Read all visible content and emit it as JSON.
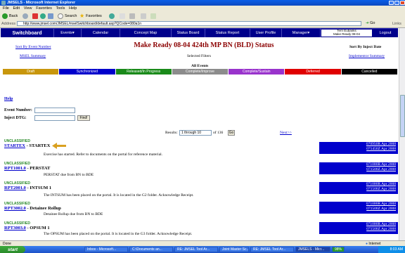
{
  "window": {
    "title": "JMSELS - Microsoft Internet Explorer"
  },
  "ie_menu": [
    "File",
    "Edit",
    "View",
    "Favorites",
    "Tools",
    "Help"
  ],
  "toolbar": {
    "back": "Back",
    "search": "Search",
    "favorites": "Favorites"
  },
  "addressbar": {
    "label": "Address",
    "url": "http://www.jmsel.com/JMSEL/mselSwitchboard/default.asp?QCode=080a1n",
    "go": "Go",
    "links": "Links"
  },
  "nav": {
    "switchboard": "Switchboard",
    "events": "Events▾",
    "calendar": "Calendar",
    "concept_map": "Concept Map",
    "status_board": "Status Board",
    "status_report": "Status Report",
    "user_profile": "User Profile",
    "managers": "Manager▾",
    "user_name": "Terri Eubanks",
    "user_event": "Make Ready 08-04",
    "logout": "Logout"
  },
  "page": {
    "sort_event_number": "Sort By Event Number",
    "msel_summary": "MSEL Summary",
    "title": "Make Ready 08-04 424th MP BN (BLD) Status",
    "selected_filters": "Selected Filters",
    "sort_inject_date": "Sort By Inject Date",
    "implementor_summary": "Implementor Summary",
    "all_events": "All Events"
  },
  "legend": [
    {
      "label": "Draft",
      "color": "#c8960c"
    },
    {
      "label": "Synchronized",
      "color": "#0000cc"
    },
    {
      "label": "Released/In Progress",
      "color": "#1a8a1a"
    },
    {
      "label": "Complete/Improve",
      "color": "#8c8c8c"
    },
    {
      "label": "Complete/Sustain",
      "color": "#9933cc"
    },
    {
      "label": "Deferred",
      "color": "#e00000"
    },
    {
      "label": "Cancelled",
      "color": "#000000"
    }
  ],
  "help": "Help",
  "form": {
    "event_number_label": "Event Number:",
    "inject_dtg_label": "Inject DTG:",
    "find_button": "Find!"
  },
  "results": {
    "label": "Results:",
    "range": "1 through 10",
    "of": "of 136",
    "go": "Go",
    "next": "Next>>"
  },
  "events": [
    {
      "class": "UNCLASSIFIED",
      "id": "STARTEX",
      "name": " - STARTEX",
      "desc": "Exercise has started. Refer to documents on the portal for reference material.",
      "date1": "070950R Apr 2008",
      "date2": "071450Z Apr 2008"
    },
    {
      "class": "UNCLASSIFIED",
      "id": "RPT1001.0",
      "name": " - PERSTAT",
      "desc": "PERSTAT due from BN to BDE",
      "date1": "071000R Apr 2008",
      "date2": "071500Z Apr 2008"
    },
    {
      "class": "UNCLASSIFIED",
      "id": "RPT2001.0",
      "name": " - INTSUM 1",
      "desc": "The INTSUM has been placed on the portal. It is located in the G2 folder. Acknowledge Receipt.",
      "date1": "071000R Apr 2008",
      "date2": "071500Z Apr 2008"
    },
    {
      "class": "UNCLASSIFIED",
      "id": "RPT3002.0",
      "name": " - Detainee Rollup",
      "desc": "Detainee Rollup due from BN to BDE",
      "date1": "071000R Apr 2008",
      "date2": "071500Z Apr 2008"
    },
    {
      "class": "UNCLASSIFIED",
      "id": "RPT3003.0",
      "name": " - OPSUM 1",
      "desc": "The OPSUM has been placed on the portal. It is located in the G3 folder. Acknowledge Receipt.",
      "date1": "071000R Apr 2008",
      "date2": "071500Z Apr 2008"
    }
  ],
  "status": {
    "left": "Done",
    "zone": "Internet"
  },
  "taskbar": {
    "start": "start",
    "tasks": [
      "Inbox - Microsoft...",
      "C:\\Documents an...",
      "RE: JMSEL Tool Ar...",
      "Joint Master Sc...",
      "RE: JMSEL Tool Ar...",
      "JMSELS - Micr..."
    ],
    "clock": "8:03 AM",
    "zoom": "98%"
  }
}
